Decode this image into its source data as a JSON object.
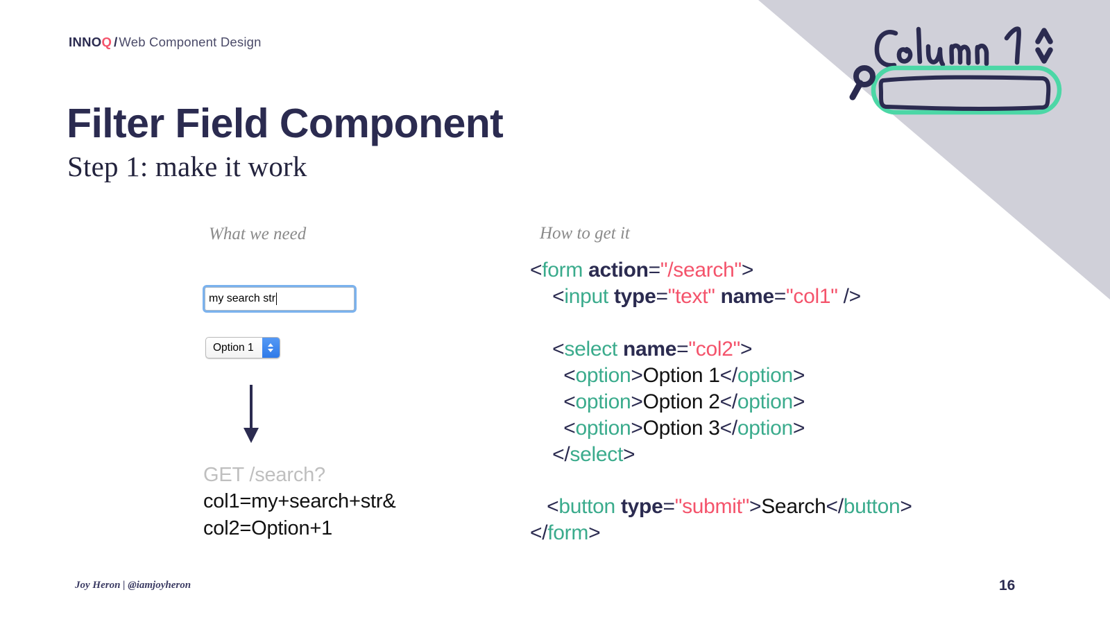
{
  "brand": {
    "logo_primary": "INNO",
    "logo_accent": "Q",
    "separator": "/",
    "deck_title": "Web Component Design"
  },
  "title": "Filter Field Component",
  "subtitle": "Step 1: make it work",
  "columns": {
    "left_label": "What we need",
    "right_label": "How to get it"
  },
  "demo": {
    "text_input": {
      "value": "my search str",
      "placeholder": "",
      "focused": true
    },
    "select": {
      "selected": "Option 1",
      "options": [
        "Option 1",
        "Option 2",
        "Option 3"
      ]
    },
    "arrow": "down-arrow",
    "request": {
      "method_line": "GET /search?",
      "query_line_1": "col1=my+search+str&",
      "query_line_2": "col2=Option+1"
    }
  },
  "code": {
    "lines": [
      [
        {
          "t": "<",
          "c": "punct"
        },
        {
          "t": "form",
          "c": "tag"
        },
        {
          "t": " ",
          "c": "punct"
        },
        {
          "t": "action",
          "c": "attr"
        },
        {
          "t": "=",
          "c": "punct"
        },
        {
          "t": "\"/search\"",
          "c": "val"
        },
        {
          "t": ">",
          "c": "punct"
        }
      ],
      [
        {
          "t": "    <",
          "c": "punct"
        },
        {
          "t": "input",
          "c": "tag"
        },
        {
          "t": " ",
          "c": "punct"
        },
        {
          "t": "type",
          "c": "attr"
        },
        {
          "t": "=",
          "c": "punct"
        },
        {
          "t": "\"text\"",
          "c": "val"
        },
        {
          "t": " ",
          "c": "punct"
        },
        {
          "t": "name",
          "c": "attr"
        },
        {
          "t": "=",
          "c": "punct"
        },
        {
          "t": "\"col1\"",
          "c": "val"
        },
        {
          "t": " />",
          "c": "punct"
        }
      ],
      [],
      [
        {
          "t": "    <",
          "c": "punct"
        },
        {
          "t": "select",
          "c": "tag"
        },
        {
          "t": " ",
          "c": "punct"
        },
        {
          "t": "name",
          "c": "attr"
        },
        {
          "t": "=",
          "c": "punct"
        },
        {
          "t": "\"col2\"",
          "c": "val"
        },
        {
          "t": ">",
          "c": "punct"
        }
      ],
      [
        {
          "t": "      <",
          "c": "punct"
        },
        {
          "t": "option",
          "c": "tag"
        },
        {
          "t": ">",
          "c": "punct"
        },
        {
          "t": "Option 1",
          "c": "text"
        },
        {
          "t": "</",
          "c": "punct"
        },
        {
          "t": "option",
          "c": "tag"
        },
        {
          "t": ">",
          "c": "punct"
        }
      ],
      [
        {
          "t": "      <",
          "c": "punct"
        },
        {
          "t": "option",
          "c": "tag"
        },
        {
          "t": ">",
          "c": "punct"
        },
        {
          "t": "Option 2",
          "c": "text"
        },
        {
          "t": "</",
          "c": "punct"
        },
        {
          "t": "option",
          "c": "tag"
        },
        {
          "t": ">",
          "c": "punct"
        }
      ],
      [
        {
          "t": "      <",
          "c": "punct"
        },
        {
          "t": "option",
          "c": "tag"
        },
        {
          "t": ">",
          "c": "punct"
        },
        {
          "t": "Option 3",
          "c": "text"
        },
        {
          "t": "</",
          "c": "punct"
        },
        {
          "t": "option",
          "c": "tag"
        },
        {
          "t": ">",
          "c": "punct"
        }
      ],
      [
        {
          "t": "    </",
          "c": "punct"
        },
        {
          "t": "select",
          "c": "tag"
        },
        {
          "t": ">",
          "c": "punct"
        }
      ],
      [],
      [
        {
          "t": "   <",
          "c": "punct"
        },
        {
          "t": "button",
          "c": "tag"
        },
        {
          "t": " ",
          "c": "punct"
        },
        {
          "t": "type",
          "c": "attr"
        },
        {
          "t": "=",
          "c": "punct"
        },
        {
          "t": "\"submit\"",
          "c": "val"
        },
        {
          "t": ">",
          "c": "punct"
        },
        {
          "t": "Search",
          "c": "text"
        },
        {
          "t": "</",
          "c": "punct"
        },
        {
          "t": "button",
          "c": "tag"
        },
        {
          "t": ">",
          "c": "punct"
        }
      ],
      [
        {
          "t": "</",
          "c": "punct"
        },
        {
          "t": "form",
          "c": "tag"
        },
        {
          "t": ">",
          "c": "punct"
        }
      ]
    ]
  },
  "sketch": {
    "label": "Column 1",
    "icons": [
      "chevron-up-down-icon",
      "magnifier-icon"
    ],
    "highlight_color": "#4cd7a6",
    "ink_color": "#2b2b50"
  },
  "footer": {
    "author": "Joy Heron | @iamjoyheron",
    "page_number": "16"
  },
  "colors": {
    "navy": "#2b2b50",
    "coral": "#f4536b",
    "teal": "#3aab8c",
    "gray_triangle": "#d0d0d9",
    "muted": "#8a8a8a"
  }
}
